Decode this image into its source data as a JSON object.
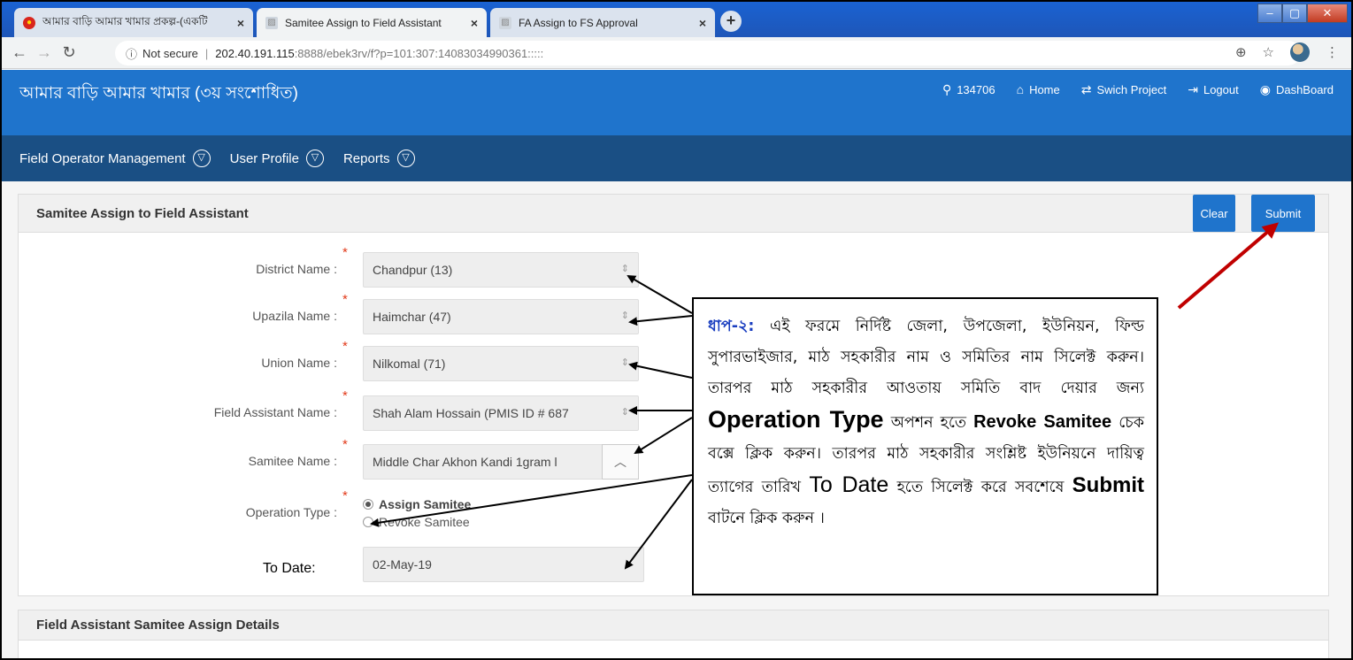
{
  "browser": {
    "tabs": [
      {
        "title": "আমার বাড়ি আমার খামার প্রকল্প-(একটি"
      },
      {
        "title": "Samitee Assign to Field Assistant"
      },
      {
        "title": "FA Assign to FS Approval"
      }
    ],
    "close_glyph": "×",
    "new_tab_glyph": "+",
    "security_label": "Not secure",
    "url_host": "202.40.191.115",
    "url_path": ":8888/ebek3rv/f?p=101:307:14083034990361:::::"
  },
  "app": {
    "title": "আমার বাড়ি আমার খামার (৩য় সংশোধিত)",
    "user_id": "134706",
    "home_label": "Home",
    "switch_label": "Swich Project",
    "logout_label": "Logout",
    "dashboard_label": "DashBoard"
  },
  "menu": {
    "items": [
      {
        "label": "Field Operator Management"
      },
      {
        "label": "User Profile"
      },
      {
        "label": "Reports"
      }
    ]
  },
  "form": {
    "region_title": "Samitee Assign to Field Assistant",
    "clear_label": "Clear",
    "submit_label": "Submit",
    "required_marker": "*",
    "district": {
      "label": "District Name :",
      "value": "Chandpur (13)"
    },
    "upazila": {
      "label": "Upazila Name :",
      "value": "Haimchar (47)"
    },
    "union": {
      "label": "Union Name :",
      "value": "Nilkomal (71)"
    },
    "field_assistant": {
      "label": "Field Assistant Name :",
      "value": "Shah Alam Hossain (PMIS ID # 687"
    },
    "samitee": {
      "label": "Samitee Name :",
      "value": "Middle Char Akhon Kandi 1gram l"
    },
    "operation_type": {
      "label": "Operation Type :",
      "options": [
        "Assign Samitee",
        "Revoke Samitee"
      ],
      "selected": "Assign Samitee"
    },
    "to_date": {
      "label": "To Date:",
      "value": "02-May-19"
    }
  },
  "details": {
    "region_title": "Field Assistant Samitee Assign Details"
  },
  "callout": {
    "step": "ধাপ-২:",
    "t1": " এই ফরমে নির্দিষ্ট  জেলা, উপজেলা, ইউনিয়ন, ফিল্ড সুপারভাইজার, মাঠ সহকারীর নাম ও সমিতির নাম সিলেক্ট করুন। তারপর মাঠ সহকারীর আওতায় সমিতি বাদ দেয়ার জন্য ",
    "operation_type": "Operation Type",
    "t2": " অপশন হতে ",
    "revoke": "Revoke Samitee",
    "t3": " চেক বক্সে ক্লিক করুন। তারপর মাঠ সহকারীর সংশ্লিষ্ট ইউনিয়নে দায়িত্ব ত্যাগের তারিখ ",
    "to_date": "To Date",
    "t4": " হতে সিলেক্ট করে সবশেষে ",
    "submit": "Submit",
    "t5": " বাটনে ক্লিক করুন ।"
  },
  "colors": {
    "app_header": "#1f74cc",
    "menu_bar": "#1a4f84",
    "arrow_red": "#c00000",
    "step_blue": "#1a3ec0"
  }
}
